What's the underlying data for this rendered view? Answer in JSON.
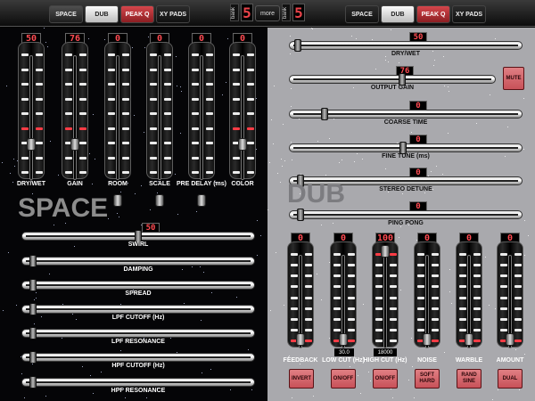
{
  "left_tabs": [
    "SPACE",
    "DUB",
    "PEAK Q",
    "XY PADS"
  ],
  "right_tabs": [
    "SPACE",
    "DUB",
    "PEAK Q",
    "XY PADS"
  ],
  "bank_label": "bank",
  "left_bank_value": "5",
  "right_bank_value": "5",
  "more_label": "more",
  "space": {
    "title": "SPACE",
    "vfaders": [
      {
        "label": "DRY/WET",
        "value": "50",
        "level": 0.5
      },
      {
        "label": "GAIN",
        "value": "76",
        "level": 0.5
      },
      {
        "label": "ROOM",
        "value": "0",
        "level": 0.0
      },
      {
        "label": "SCALE",
        "value": "0",
        "level": 0.0
      },
      {
        "label": "PRE DELAY (ms)",
        "value": "0",
        "level": 0.0
      },
      {
        "label": "COLOR",
        "value": "0",
        "level": 0.5
      }
    ],
    "hfaders": [
      {
        "label": "SWIRL",
        "value": "50"
      },
      {
        "label": "DAMPING",
        "value": ""
      },
      {
        "label": "SPREAD",
        "value": ""
      },
      {
        "label": "LPF CUTOFF (Hz)",
        "value": ""
      },
      {
        "label": "LPF RESONANCE",
        "value": ""
      },
      {
        "label": "HPF CUTOFF (Hz)",
        "value": ""
      },
      {
        "label": "HPF RESONANCE",
        "value": ""
      }
    ]
  },
  "dub": {
    "title": "DUB",
    "hfaders": [
      {
        "label": "DRY/WET",
        "value": "50"
      },
      {
        "label": "OUTPUT GAIN",
        "value": "76"
      },
      {
        "label": "COARSE TIME",
        "value": "0"
      },
      {
        "label": "FINE TUNE (ms)",
        "value": "0"
      },
      {
        "label": "STEREO DETUNE",
        "value": "0"
      },
      {
        "label": "PING PONG",
        "value": "0"
      }
    ],
    "mute_label": "MUTE",
    "vfaders": [
      {
        "label": "FEEDBACK",
        "value": "0",
        "level": 0.0
      },
      {
        "label": "LOW CUT (Hz)",
        "value": "0",
        "level": 0.0
      },
      {
        "label": "HIGH CUT (Hz)",
        "value": "100",
        "level": 1.0
      },
      {
        "label": "NOISE",
        "value": "0",
        "level": 0.0
      },
      {
        "label": "WARBLE",
        "value": "0",
        "level": 0.0
      },
      {
        "label": "AMOUNT",
        "value": "0",
        "level": 0.0
      }
    ],
    "freq_readouts": [
      "30.0",
      "18000"
    ],
    "buttons": [
      "INVERT",
      "ON/OFF",
      "ON/OFF",
      "SOFT HARD",
      "RAND SINE",
      "DUAL"
    ]
  },
  "colors": {
    "accent_red": "#ff3c45",
    "button_red": "#d0646b",
    "dub_bg": "#a9a9ad",
    "space_bg": "#050507"
  }
}
